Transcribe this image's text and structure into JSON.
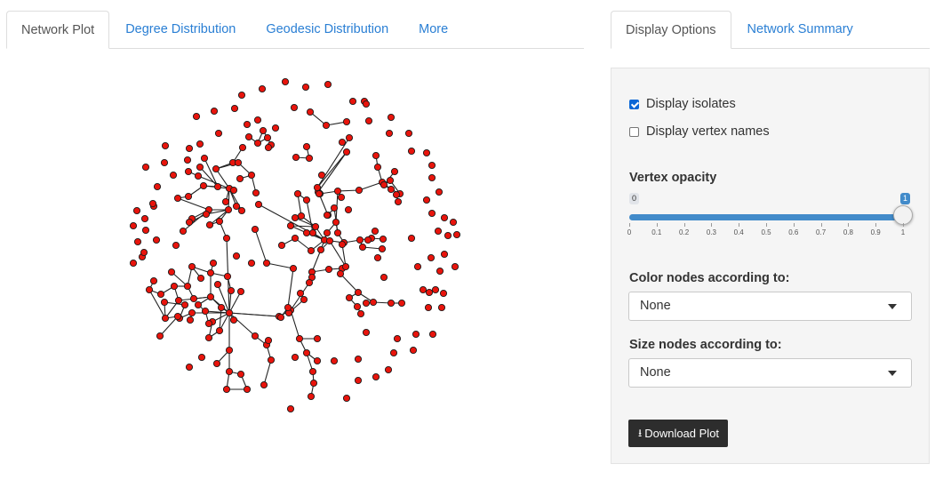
{
  "left_tabs": [
    {
      "label": "Network Plot",
      "active": true
    },
    {
      "label": "Degree Distribution",
      "active": false
    },
    {
      "label": "Geodesic Distribution",
      "active": false
    },
    {
      "label": "More",
      "active": false
    }
  ],
  "right_tabs": [
    {
      "label": "Display Options",
      "active": true
    },
    {
      "label": "Network Summary",
      "active": false
    }
  ],
  "options": {
    "display_isolates": {
      "label": "Display isolates",
      "checked": true
    },
    "display_vertex_names": {
      "label": "Display vertex names",
      "checked": false
    },
    "vertex_opacity": {
      "label": "Vertex opacity",
      "min_label": "0",
      "max_label": "1",
      "value": 1,
      "min": 0,
      "max": 1,
      "ticks": [
        "0",
        "0.1",
        "0.2",
        "0.3",
        "0.4",
        "0.5",
        "0.6",
        "0.7",
        "0.8",
        "0.9",
        "1"
      ]
    },
    "color_nodes": {
      "label": "Color nodes according to:",
      "value": "None"
    },
    "size_nodes": {
      "label": "Size nodes according to:",
      "value": "None"
    },
    "download_button": {
      "label": "Download Plot",
      "icon": "download-icon"
    }
  },
  "colors": {
    "node_fill": "#e8140c",
    "node_stroke": "#1a1a1a",
    "tab_link": "#2a7fd4",
    "slider_fill": "#428bca",
    "button_bg": "#2d2d2d"
  }
}
